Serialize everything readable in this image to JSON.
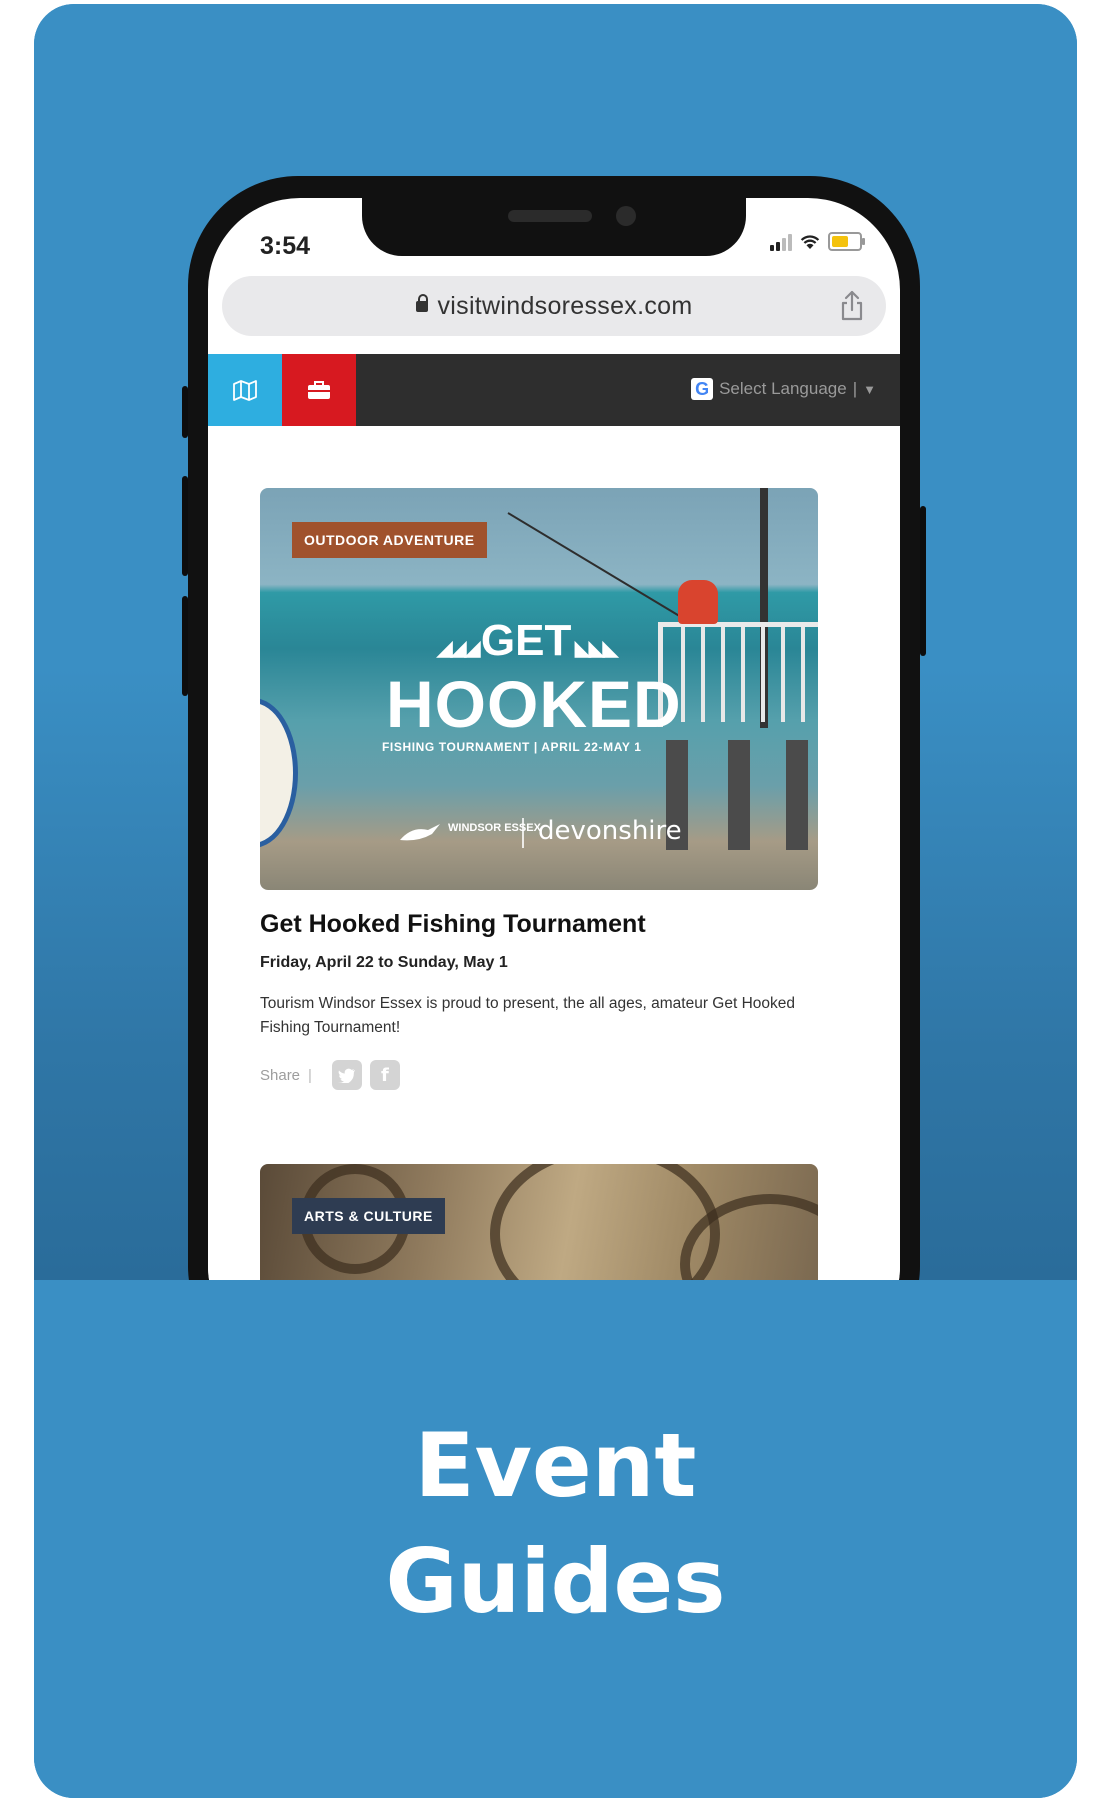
{
  "card": {
    "heading_line1": "Event",
    "heading_line2": "Guides",
    "colors": {
      "card_blue": "#3a8fc4"
    }
  },
  "phone": {
    "status_bar": {
      "time": "3:54"
    },
    "browser": {
      "url": "visitwindsoressex.com"
    },
    "navbar": {
      "map_icon": "map-icon",
      "briefcase_icon": "briefcase-icon",
      "language_select": "Select Language",
      "language_caret": "▼",
      "google_icon": "G"
    },
    "events": [
      {
        "tag": "OUTDOOR ADVENTURE",
        "image_text": {
          "get": "GET",
          "hooked": "HOOKED",
          "subtitle": "FISHING TOURNAMENT | APRIL 22-MAY 1",
          "sponsor": "devonshire",
          "logo": "WINDSOR ESSEX"
        },
        "title": "Get Hooked Fishing Tournament",
        "date": "Friday, April 22 to Sunday, May 1",
        "description": "Tourism Windsor Essex is proud to present, the all ages, amateur Get Hooked Fishing Tournament!",
        "share_label": "Share",
        "share_separator": "|"
      },
      {
        "tag": "ARTS & CULTURE"
      }
    ]
  }
}
